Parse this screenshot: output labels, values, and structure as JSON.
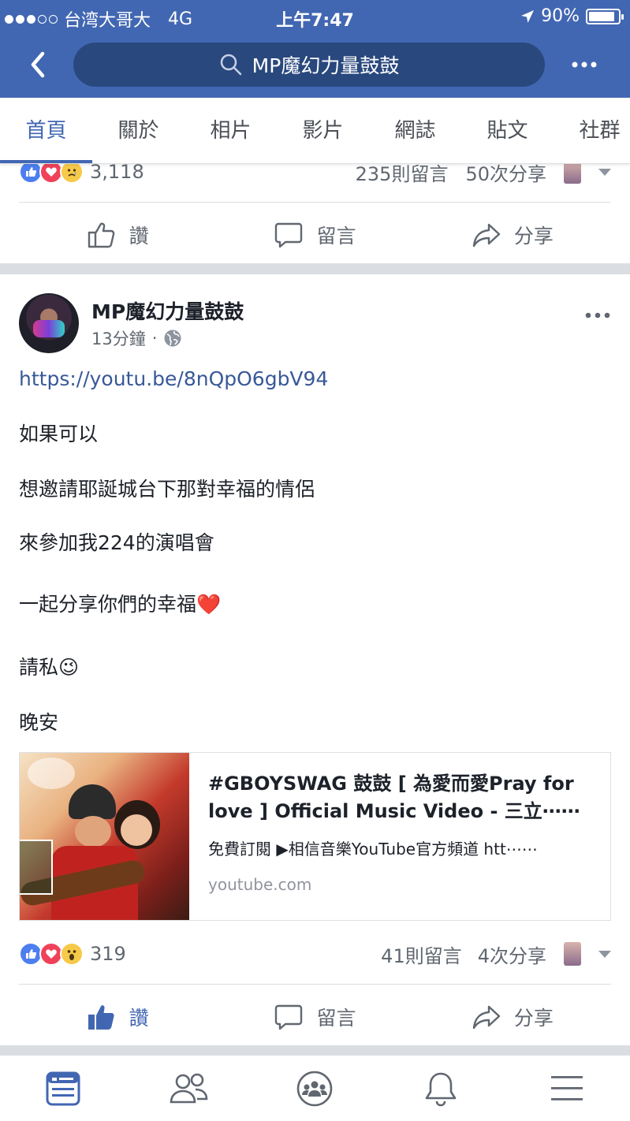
{
  "status": {
    "carrier": "台湾大哥大",
    "network": "4G",
    "time": "上午7:47",
    "battery": "90%",
    "battery_level": 0.9
  },
  "navbar": {
    "search_text": "MP魔幻力量鼓鼓",
    "icons": [
      "back-chevron-icon",
      "search-icon",
      "more-dots-icon"
    ]
  },
  "tabs": [
    {
      "label": "首頁",
      "active": true
    },
    {
      "label": "關於"
    },
    {
      "label": "相片"
    },
    {
      "label": "影片"
    },
    {
      "label": "網誌"
    },
    {
      "label": "貼文"
    },
    {
      "label": "社群"
    }
  ],
  "prev_post": {
    "reaction_count": "3,118",
    "comments": "235則留言",
    "shares": "50次分享",
    "reaction_icons": [
      "like-icon",
      "love-icon",
      "sad-icon"
    ]
  },
  "actions": {
    "like": "讚",
    "comment": "留言",
    "share": "分享"
  },
  "post": {
    "author": "MP魔幻力量鼓鼓",
    "time": "13分鐘",
    "privacy_icon": "globe-icon",
    "link": "https://youtu.be/8nQpO6gbV94",
    "lines": [
      "如果可以",
      "想邀請耶誕城台下那對幸福的情侶",
      "來參加我224的演唱會",
      "一起分享你們的幸福❤️",
      "請私😉",
      "晚安"
    ],
    "card": {
      "title": "#GBOYSWAG 鼓鼓 [ 為愛而愛Pray for love ] Official Music Video - 三立⋯⋯",
      "description": "免費訂閱 ▶相信音樂YouTube官方頻道 htt⋯⋯",
      "domain": "youtube.com"
    },
    "reaction_count": "319",
    "comments": "41則留言",
    "shares": "4次分享",
    "reaction_icons": [
      "like-icon",
      "love-icon",
      "wow-icon"
    ]
  },
  "bottom_nav": [
    "news-feed-icon",
    "friends-icon",
    "groups-icon",
    "notifications-bell-icon",
    "menu-icon"
  ],
  "colors": {
    "brand": "#4267b2",
    "search_bg": "#29487d",
    "link": "#385898"
  }
}
